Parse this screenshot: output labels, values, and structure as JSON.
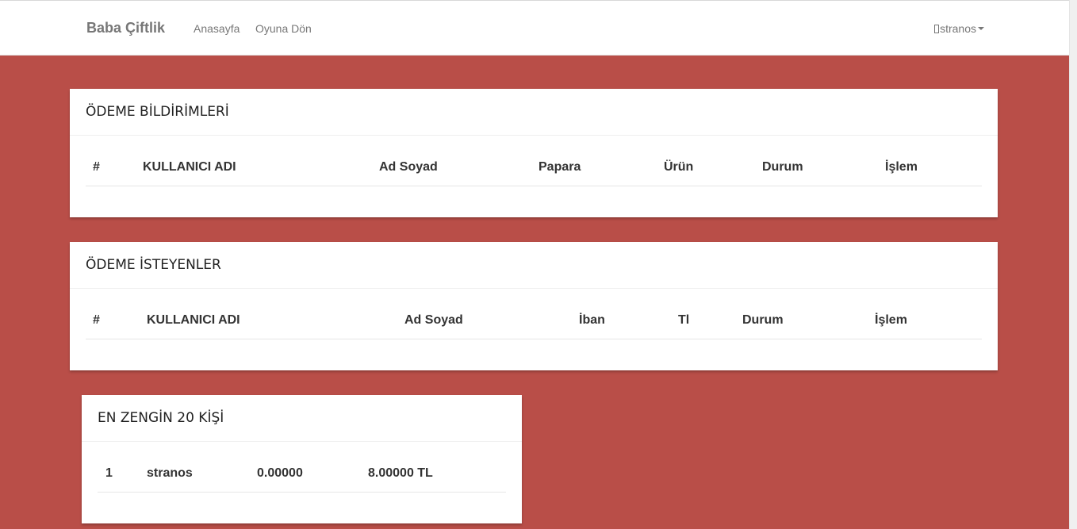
{
  "navbar": {
    "brand": "Baba Çiftlik",
    "links": [
      "Anasayfa",
      "Oyuna Dön"
    ],
    "user": "stranos"
  },
  "payment_notifications": {
    "title": "ÖDEME BİLDİRİMLERİ",
    "columns": [
      "#",
      "KULLANICI ADI",
      "Ad Soyad",
      "Papara",
      "Ürün",
      "Durum",
      "İşlem"
    ]
  },
  "payment_requests": {
    "title": "ÖDEME İSTEYENLER",
    "columns": [
      "#",
      "KULLANICI ADI",
      "Ad Soyad",
      "İban",
      "Tl",
      "Durum",
      "İşlem"
    ]
  },
  "richest": {
    "title": "EN ZENGİN 20 KİŞİ",
    "rows": [
      [
        "1",
        "stranos",
        "0.00000",
        "8.00000 TL"
      ]
    ]
  },
  "colors": {
    "background": "#b94e48",
    "navbar": "#ffffff",
    "panel": "#ffffff"
  }
}
